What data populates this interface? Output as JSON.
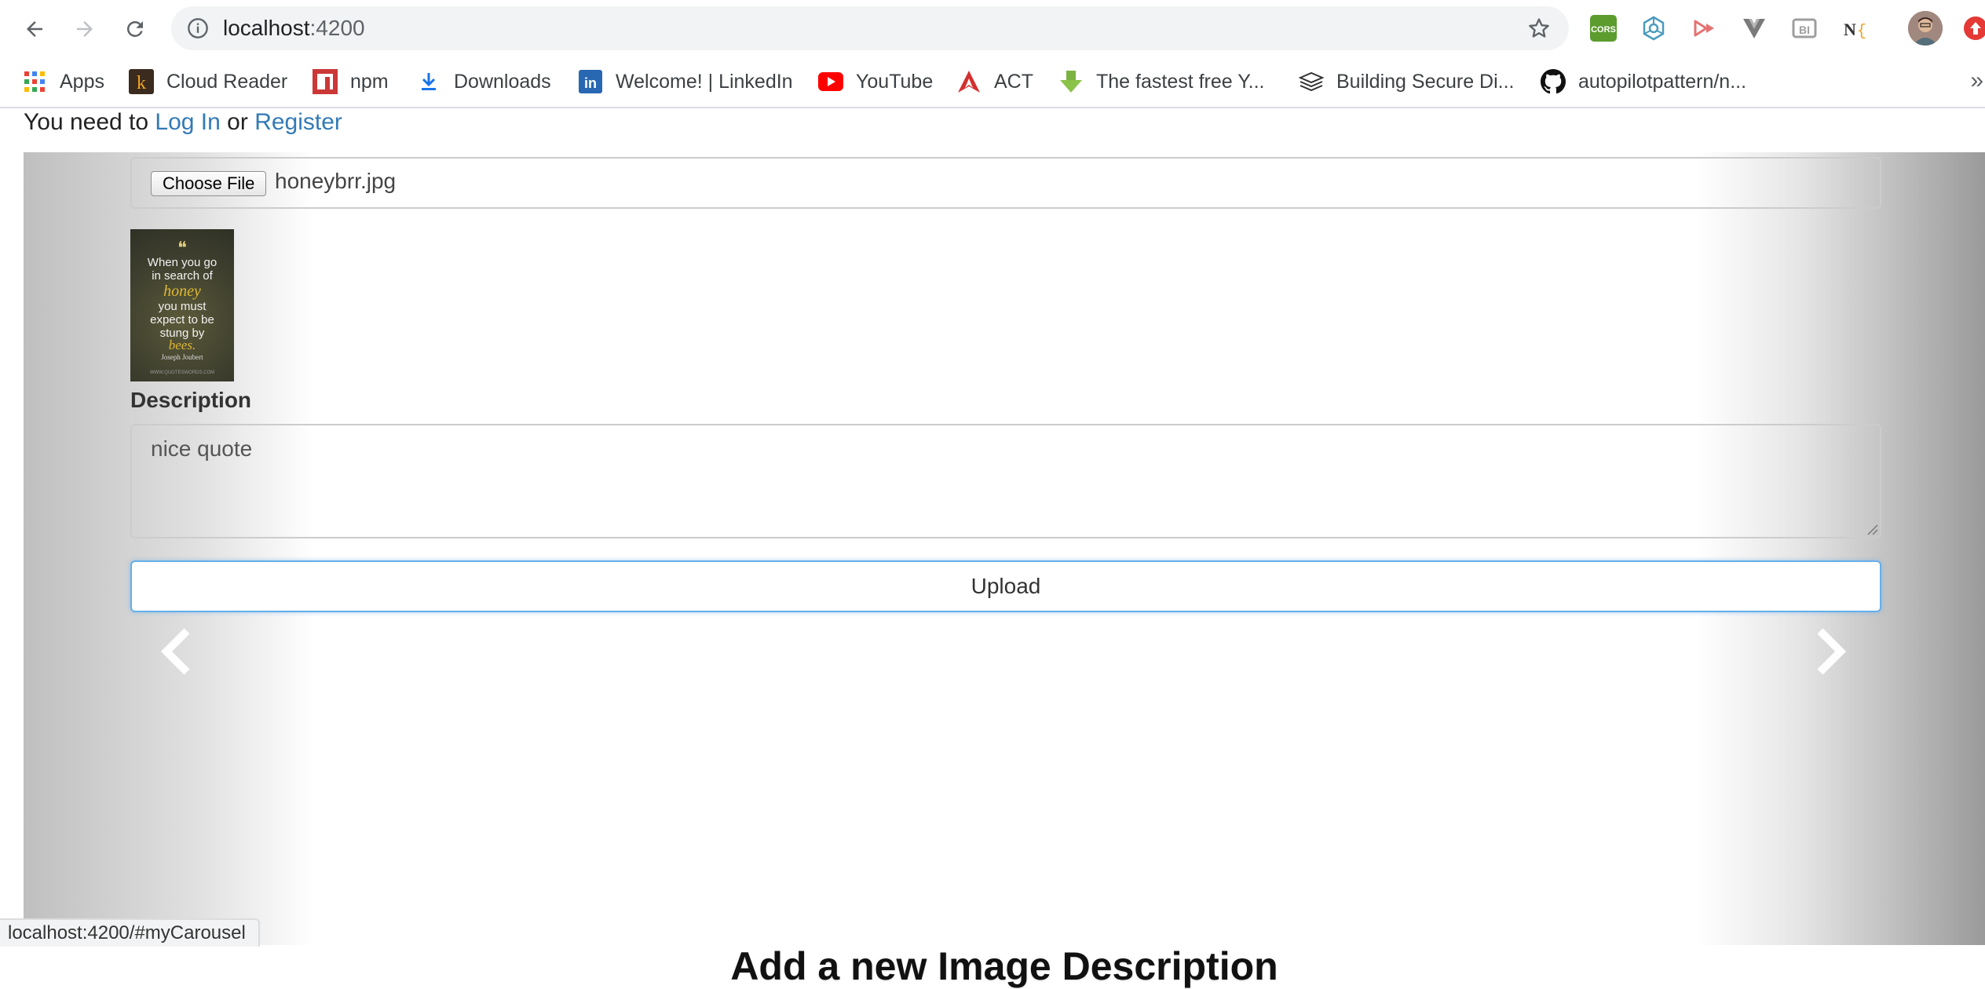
{
  "browser": {
    "url_host": "localhost",
    "url_port": ":4200",
    "status_url": "localhost:4200/#myCarousel",
    "bookmarks": [
      {
        "label": "Apps",
        "icon": "apps-grid-icon"
      },
      {
        "label": "Cloud Reader",
        "icon": "kindle-icon"
      },
      {
        "label": "npm",
        "icon": "npm-icon"
      },
      {
        "label": "Downloads",
        "icon": "download-icon"
      },
      {
        "label": "Welcome! | LinkedIn",
        "icon": "linkedin-icon"
      },
      {
        "label": "YouTube",
        "icon": "youtube-icon"
      },
      {
        "label": "ACT",
        "icon": "act-icon"
      },
      {
        "label": "The fastest free Y...",
        "icon": "download-arrow-icon"
      },
      {
        "label": "Building Secure Di...",
        "icon": "books-icon"
      },
      {
        "label": "autopilotpattern/n...",
        "icon": "github-icon"
      }
    ],
    "bookmarks_more": "»",
    "extensions": [
      "cors-icon",
      "extension-network-icon",
      "extension-arrow-icon",
      "vue-icon",
      "extension-bi-icon",
      "extension-ni-icon",
      "profile-avatar",
      "extension-red-icon"
    ]
  },
  "auth": {
    "prefix": "You need to",
    "login": "Log In",
    "or": "or",
    "register": "Register"
  },
  "form": {
    "choose_file_label": "Choose File",
    "file_name": "honeybrr.jpg",
    "preview": {
      "quote_mark": "❝",
      "line1": "When you go",
      "line2": "in search of",
      "word_honey": "honey",
      "line3": "you must",
      "line4": "expect to be",
      "line5": "stung by",
      "word_bees": "bees.",
      "author": "Joseph Joubert",
      "site": "WWW.QUOTESWORDS.COM"
    },
    "description_label": "Description",
    "description_value": "nice quote",
    "upload_label": "Upload"
  },
  "heading": "Add a new Image Description",
  "colors": {
    "link": "#337ab7",
    "focus_border": "#66afe9",
    "omnibox_bg": "#f1f3f4"
  }
}
